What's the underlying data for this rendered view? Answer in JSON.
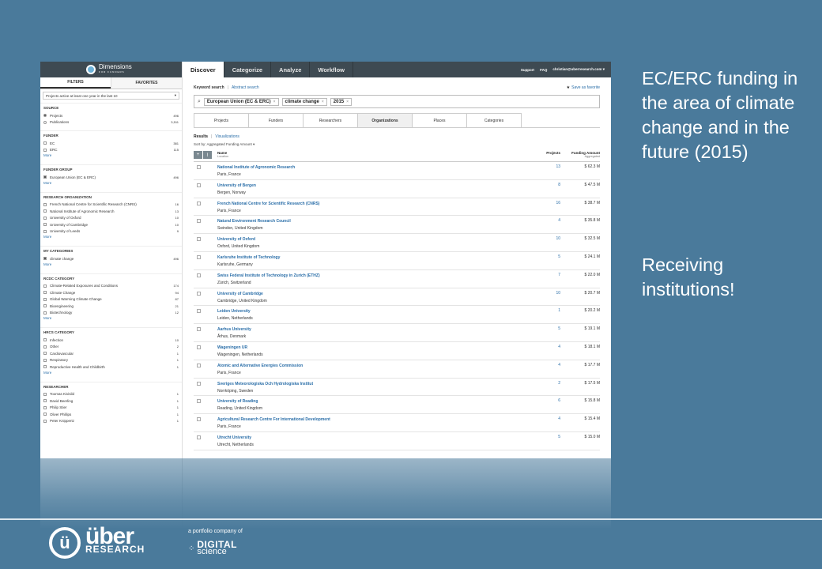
{
  "sidebar": {
    "logo_title": "Dimensions",
    "logo_subtitle": "FOR FUNDERS",
    "tabs": [
      "FILTERS",
      "FAVORITES"
    ],
    "time_filter": "Projects active at least one year in the last 10",
    "groups": [
      {
        "title": "SOURCE",
        "type": "radio",
        "items": [
          {
            "label": "Projects",
            "count": "496",
            "checked": true
          },
          {
            "label": "Publications",
            "count": "3,511",
            "checked": false
          }
        ],
        "more": ""
      },
      {
        "title": "FUNDER",
        "type": "check",
        "items": [
          {
            "label": "EC",
            "count": "381",
            "checked": false
          },
          {
            "label": "ERC",
            "count": "115",
            "checked": false
          }
        ],
        "more": "More"
      },
      {
        "title": "FUNDER GROUP",
        "type": "check",
        "items": [
          {
            "label": "European Union (EC & ERC)",
            "count": "496",
            "checked": true
          }
        ],
        "more": "More"
      },
      {
        "title": "RESEARCH ORGANIZATION",
        "type": "check",
        "items": [
          {
            "label": "French National Centre for Scientific Research (CNRS)",
            "count": "16",
            "checked": false
          },
          {
            "label": "National Institute of Agronomic Research",
            "count": "13",
            "checked": false
          },
          {
            "label": "University of Oxford",
            "count": "10",
            "checked": false
          },
          {
            "label": "University of Cambridge",
            "count": "10",
            "checked": false
          },
          {
            "label": "University of Leeds",
            "count": "9",
            "checked": false
          }
        ],
        "more": "More"
      },
      {
        "title": "MY CATEGORIES",
        "type": "check",
        "items": [
          {
            "label": "climate change",
            "count": "496",
            "checked": true
          }
        ],
        "more": "More"
      },
      {
        "title": "RCDC CATEGORY",
        "type": "check",
        "items": [
          {
            "label": "Climate-Related Exposures and Conditions",
            "count": "174",
            "checked": false
          },
          {
            "label": "Climate Change",
            "count": "94",
            "checked": false
          },
          {
            "label": "Global Warming Climate Change",
            "count": "87",
            "checked": false
          },
          {
            "label": "Bioengineering",
            "count": "21",
            "checked": false
          },
          {
            "label": "Biotechnology",
            "count": "12",
            "checked": false
          }
        ],
        "more": "More"
      },
      {
        "title": "HRCS CATEGORY",
        "type": "check",
        "items": [
          {
            "label": "Infection",
            "count": "10",
            "checked": false
          },
          {
            "label": "Other",
            "count": "2",
            "checked": false
          },
          {
            "label": "Cardiovascular",
            "count": "1",
            "checked": false
          },
          {
            "label": "Respiratory",
            "count": "1",
            "checked": false
          },
          {
            "label": "Reproductive Health and Childbirth",
            "count": "1",
            "checked": false
          }
        ],
        "more": "More"
      },
      {
        "title": "RESEARCHER",
        "type": "check",
        "items": [
          {
            "label": "Toomas Kivisild",
            "count": "1",
            "checked": false
          },
          {
            "label": "David Beerling",
            "count": "1",
            "checked": false
          },
          {
            "label": "Philip Stier",
            "count": "1",
            "checked": false
          },
          {
            "label": "Oliver Phillips",
            "count": "1",
            "checked": false
          },
          {
            "label": "Peter Knippertz",
            "count": "1",
            "checked": false
          }
        ],
        "more": ""
      }
    ]
  },
  "topnav": {
    "tabs": [
      "Discover",
      "Categorize",
      "Analyze",
      "Workflow"
    ],
    "active": 0,
    "support": "Support",
    "faq": "FAQ",
    "user": "christian@uberresearch.com ▾"
  },
  "search": {
    "keyword_label": "Keyword search",
    "abstract_label": "Abstract search",
    "save_label": "Save as favorite",
    "chips": [
      "European Union (EC & ERC)",
      "climate change",
      "2015"
    ]
  },
  "result_tabs": {
    "tabs": [
      "Projects",
      "Funders",
      "Researchers",
      "Organizations",
      "Places",
      "Categories"
    ],
    "active": 3
  },
  "results": {
    "results_label": "Results",
    "visualizations_label": "Visualizations",
    "sort_label": "Sort by: Aggregated Funding Amount ▾",
    "col_name": "Name",
    "col_location": "Location",
    "col_projects": "Projects",
    "col_funding": "Funding Amount",
    "col_funding_sub": "Aggregated",
    "rows": [
      {
        "name": "National Institute of Agronomic Research",
        "location": "Paris, France",
        "projects": "13",
        "funding": "$ 62.3 M"
      },
      {
        "name": "University of Bergen",
        "location": "Bergen, Norway",
        "projects": "8",
        "funding": "$ 47.5 M"
      },
      {
        "name": "French National Centre for Scientific Research (CNRS)",
        "location": "Paris, France",
        "projects": "16",
        "funding": "$ 38.7 M"
      },
      {
        "name": "Natural Environment Research Council",
        "location": "Swindon, United Kingdom",
        "projects": "4",
        "funding": "$ 35.8 M"
      },
      {
        "name": "University of Oxford",
        "location": "Oxford, United Kingdom",
        "projects": "10",
        "funding": "$ 32.5 M"
      },
      {
        "name": "Karlsruhe Institute of Technology",
        "location": "Karlsruhe, Germany",
        "projects": "5",
        "funding": "$ 24.1 M"
      },
      {
        "name": "Swiss Federal Institute of Technology in Zurich (ETHZ)",
        "location": "Zürich, Switzerland",
        "projects": "7",
        "funding": "$ 22.0 M"
      },
      {
        "name": "University of Cambridge",
        "location": "Cambridge, United Kingdom",
        "projects": "10",
        "funding": "$ 20.7 M"
      },
      {
        "name": "Leiden University",
        "location": "Leiden, Netherlands",
        "projects": "1",
        "funding": "$ 20.2 M"
      },
      {
        "name": "Aarhus University",
        "location": "Århus, Denmark",
        "projects": "5",
        "funding": "$ 19.1 M"
      },
      {
        "name": "Wageningen UR",
        "location": "Wageningen, Netherlands",
        "projects": "4",
        "funding": "$ 18.1 M"
      },
      {
        "name": "Atomic and Alternative Energies Commission",
        "location": "Paris, France",
        "projects": "4",
        "funding": "$ 17.7 M"
      },
      {
        "name": "Sveriges Meteorologiska Och Hydrologiska Institut",
        "location": "Norrköping, Sweden",
        "projects": "2",
        "funding": "$ 17.5 M"
      },
      {
        "name": "University of Reading",
        "location": "Reading, United Kingdom",
        "projects": "6",
        "funding": "$ 15.8 M"
      },
      {
        "name": "Agricultural Research Centre For International Development",
        "location": "Paris, France",
        "projects": "4",
        "funding": "$ 15.4 M"
      },
      {
        "name": "Utrecht University",
        "location": "Utrecht, Netherlands",
        "projects": "5",
        "funding": "$ 15.0 M"
      }
    ]
  },
  "slide": {
    "text1": "EC/ERC funding in the area of climate change and in the future (2015)",
    "text2": "Receiving institutions!",
    "brand_letter": "ü",
    "brand_big": "über",
    "brand_small": "RESEARCH",
    "portfolio": "a portfolio company of",
    "digital1": "DIGITAL",
    "digital2": "science"
  }
}
